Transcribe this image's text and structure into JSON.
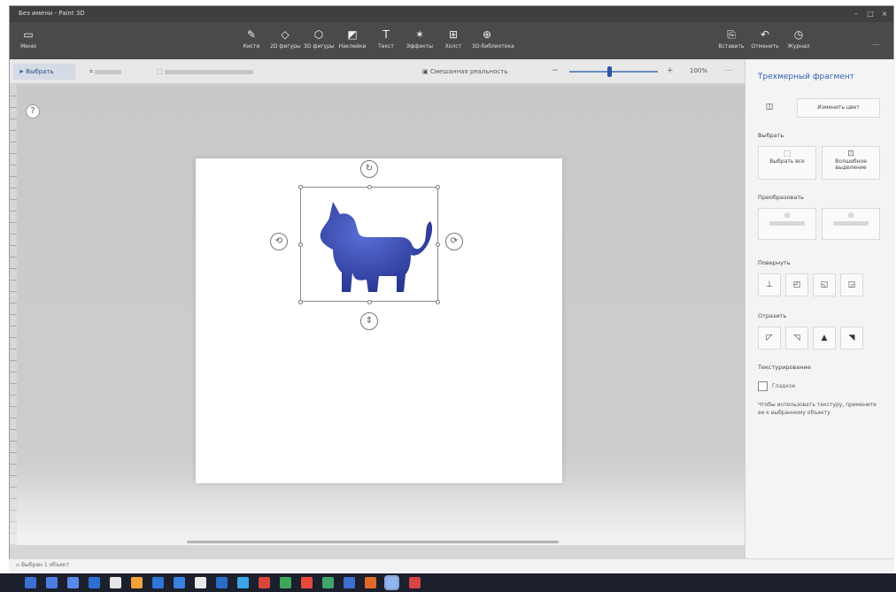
{
  "window": {
    "title": "Без имени - Paint 3D"
  },
  "ribbon": {
    "menu_label": "Меню",
    "tools": [
      {
        "name": "brushes",
        "label": "Кисти",
        "icon": "brush-icon"
      },
      {
        "name": "shapes2d",
        "label": "2D фигуры",
        "icon": "shapes-2d-icon"
      },
      {
        "name": "shapes3d",
        "label": "3D фигуры",
        "icon": "shapes-3d-icon"
      },
      {
        "name": "stickers",
        "label": "Наклейки",
        "icon": "sticker-icon"
      },
      {
        "name": "text",
        "label": "Текст",
        "icon": "text-icon"
      },
      {
        "name": "effects",
        "label": "Эффекты",
        "icon": "effects-icon"
      },
      {
        "name": "canvas",
        "label": "Холст",
        "icon": "canvas-icon"
      },
      {
        "name": "library",
        "label": "3D-библиотека",
        "icon": "library-icon"
      }
    ],
    "right_tools": [
      {
        "name": "paste",
        "label": "Вставить",
        "icon": "paste-icon"
      },
      {
        "name": "undo",
        "label": "Отменить",
        "icon": "undo-icon"
      },
      {
        "name": "history",
        "label": "Журнал",
        "icon": "history-icon"
      }
    ]
  },
  "toolbar": {
    "select_label": "Выбрать",
    "mixed_reality_label": "Смешанная реальность",
    "zoom_value": "100%",
    "zoom_level": 0.45
  },
  "panel": {
    "title": "Трехмерный фрагмент",
    "sections": {
      "edit_color": "Изменить цвет",
      "selection": "Выбрать",
      "transform": "Преобразовать",
      "rotate": "Повернуть",
      "flip": "Отразить",
      "texturing": "Текстурирование"
    },
    "buttons": {
      "select_all": "Выбрать все",
      "magic_select": "Волшебное выделение",
      "smooth": "Гладкое"
    },
    "help_text": "Чтобы использовать текстуру, примените ее к выбранному объекту"
  },
  "status": {
    "text": "Выбран 1 объект"
  },
  "colors": {
    "accent": "#2b5fb3",
    "cat": "#3447b3",
    "ribbon": "#4a4a4a",
    "taskbar": "#1c1f2c"
  }
}
